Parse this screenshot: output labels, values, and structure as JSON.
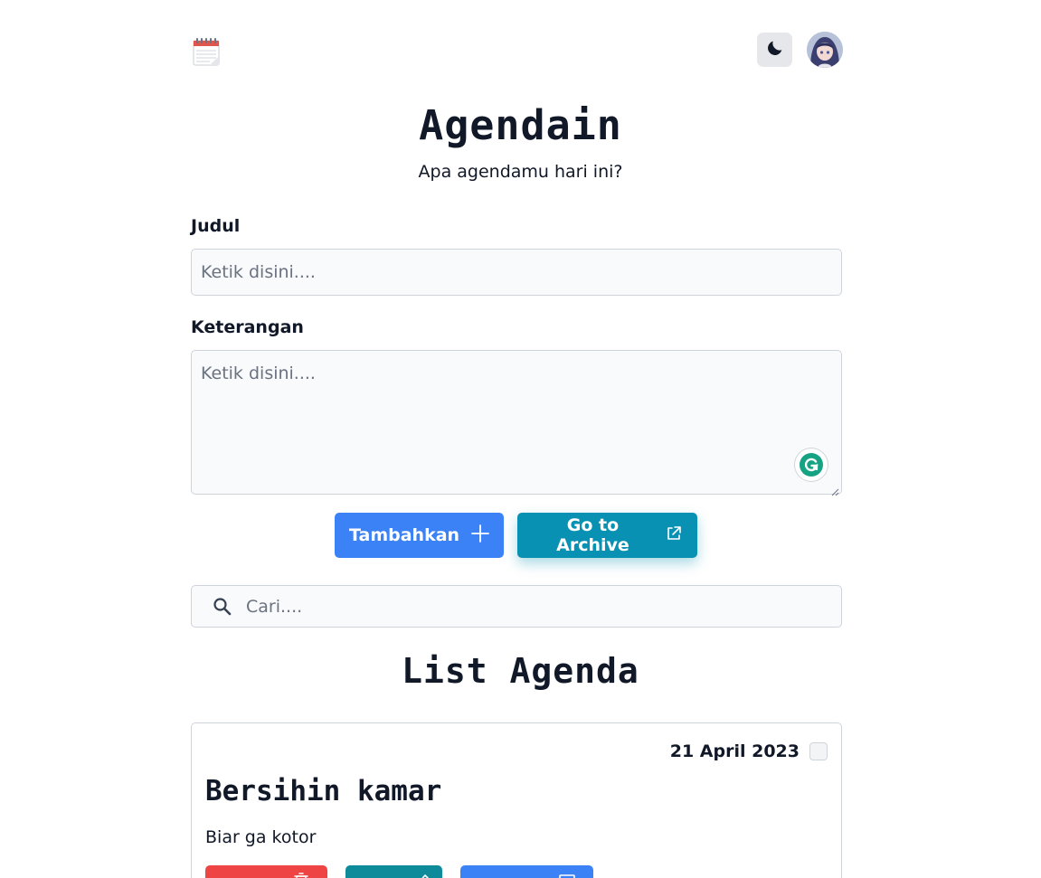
{
  "header": {
    "logo_icon": "notepad-calendar-icon",
    "theme_icon": "moon-icon",
    "avatar_icon": "user-avatar"
  },
  "app": {
    "title": "Agendain",
    "subtitle": "Apa agendamu hari ini?"
  },
  "form": {
    "title_label": "Judul",
    "title_placeholder": "Ketik disini....",
    "desc_label": "Keterangan",
    "desc_placeholder": "Ketik disini....",
    "add_button": "Tambahkan",
    "archive_button": "Go to Archive"
  },
  "search": {
    "placeholder": "Cari...."
  },
  "list": {
    "title": "List Agenda",
    "items": [
      {
        "date": "21 April 2023",
        "title": "Bersihin kamar",
        "description": "Biar ga kotor"
      }
    ]
  },
  "colors": {
    "primary": "#3b82f6",
    "teal": "#0891b2",
    "danger": "#ef4444"
  }
}
